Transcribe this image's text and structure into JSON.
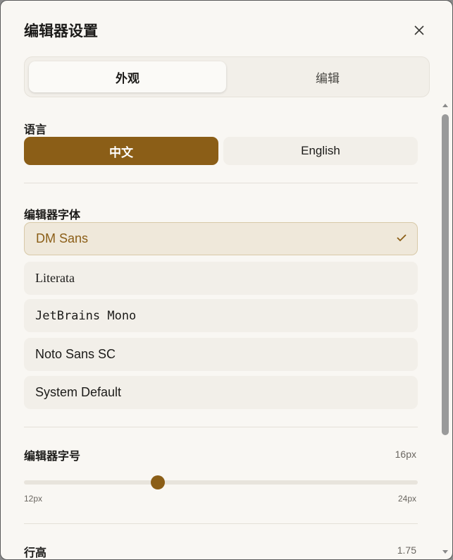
{
  "dialog": {
    "title": "编辑器设置",
    "close_icon": "close-icon"
  },
  "tabs": [
    {
      "label": "外观",
      "active": true
    },
    {
      "label": "编辑",
      "active": false
    }
  ],
  "language": {
    "label": "语言",
    "options": [
      "中文",
      "English"
    ],
    "selected": "中文"
  },
  "font": {
    "label": "编辑器字体",
    "options": [
      "DM Sans",
      "Literata",
      "JetBrains Mono",
      "Noto Sans SC",
      "System Default"
    ],
    "selected": "DM Sans",
    "check_icon": "check-icon"
  },
  "font_size": {
    "label": "编辑器字号",
    "value_text": "16px",
    "value": 16,
    "min_label": "12px",
    "max_label": "24px"
  },
  "line_height": {
    "label": "行高",
    "value_text": "1.75"
  },
  "colors": {
    "accent": "#8b5e17",
    "background": "#f9f7f3",
    "option_bg": "#f2efe9",
    "selected_bg": "#efe8da"
  }
}
